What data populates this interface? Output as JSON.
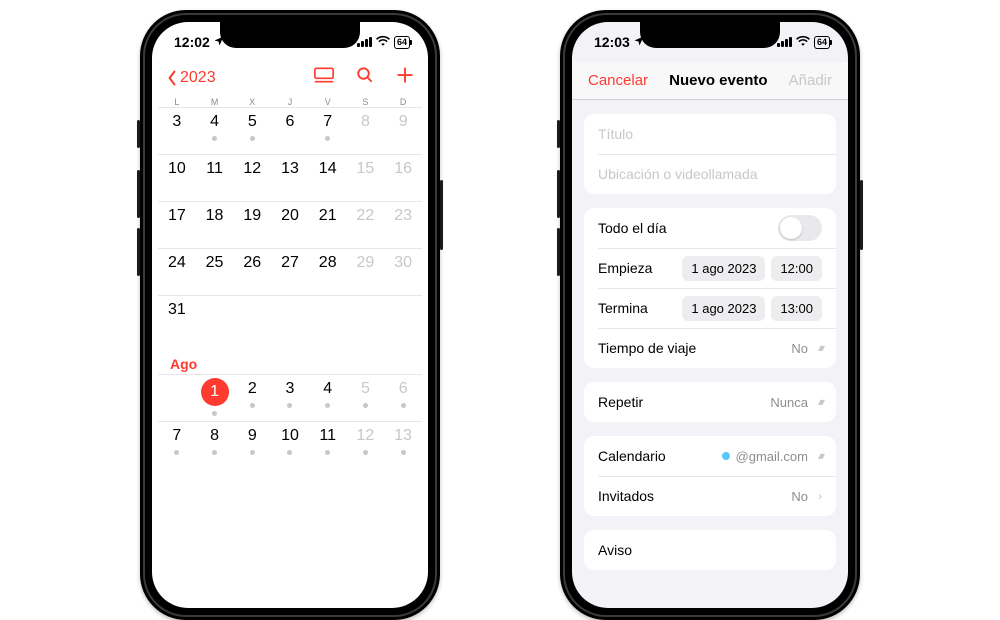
{
  "phone1": {
    "status": {
      "time": "12:02",
      "battery": "64"
    },
    "nav": {
      "back": "2023"
    },
    "dow": [
      "L",
      "M",
      "X",
      "J",
      "V",
      "S",
      "D"
    ],
    "weeks_jul": [
      [
        {
          "n": "3"
        },
        {
          "n": "4",
          "dot": true
        },
        {
          "n": "5",
          "dot": true
        },
        {
          "n": "6"
        },
        {
          "n": "7",
          "dot": true
        },
        {
          "n": "8",
          "wk": true
        },
        {
          "n": "9",
          "wk": true
        }
      ],
      [
        {
          "n": "10"
        },
        {
          "n": "11"
        },
        {
          "n": "12"
        },
        {
          "n": "13"
        },
        {
          "n": "14"
        },
        {
          "n": "15",
          "wk": true
        },
        {
          "n": "16",
          "wk": true
        }
      ],
      [
        {
          "n": "17"
        },
        {
          "n": "18"
        },
        {
          "n": "19"
        },
        {
          "n": "20"
        },
        {
          "n": "21"
        },
        {
          "n": "22",
          "wk": true
        },
        {
          "n": "23",
          "wk": true
        }
      ],
      [
        {
          "n": "24"
        },
        {
          "n": "25"
        },
        {
          "n": "26"
        },
        {
          "n": "27"
        },
        {
          "n": "28"
        },
        {
          "n": "29",
          "wk": true
        },
        {
          "n": "30",
          "wk": true
        }
      ],
      [
        {
          "n": "31"
        },
        {
          "n": ""
        },
        {
          "n": ""
        },
        {
          "n": ""
        },
        {
          "n": ""
        },
        {
          "n": ""
        },
        {
          "n": ""
        }
      ]
    ],
    "month_label": "Ago",
    "weeks_aug": [
      [
        {
          "n": ""
        },
        {
          "n": "1",
          "today": true,
          "dot": true
        },
        {
          "n": "2",
          "dot": true
        },
        {
          "n": "3",
          "dot": true
        },
        {
          "n": "4",
          "dot": true
        },
        {
          "n": "5",
          "wk": true,
          "dot": true
        },
        {
          "n": "6",
          "wk": true,
          "dot": true
        }
      ],
      [
        {
          "n": "7",
          "dot": true
        },
        {
          "n": "8",
          "dot": true
        },
        {
          "n": "9",
          "dot": true
        },
        {
          "n": "10",
          "dot": true
        },
        {
          "n": "11",
          "dot": true
        },
        {
          "n": "12",
          "wk": true,
          "dot": true
        },
        {
          "n": "13",
          "wk": true,
          "dot": true
        }
      ]
    ]
  },
  "phone2": {
    "status": {
      "time": "12:03",
      "battery": "64"
    },
    "nav": {
      "cancel": "Cancelar",
      "title": "Nuevo evento",
      "add": "Añadir"
    },
    "fields": {
      "title_ph": "Título",
      "location_ph": "Ubicación o videollamada",
      "allday": "Todo el día",
      "starts": "Empieza",
      "starts_date": "1 ago 2023",
      "starts_time": "12:00",
      "ends": "Termina",
      "ends_date": "1 ago 2023",
      "ends_time": "13:00",
      "travel": "Tiempo de viaje",
      "travel_val": "No",
      "repeat": "Repetir",
      "repeat_val": "Nunca",
      "calendar": "Calendario",
      "calendar_val": "@gmail.com",
      "invitees": "Invitados",
      "invitees_val": "No",
      "alert": "Aviso"
    }
  }
}
